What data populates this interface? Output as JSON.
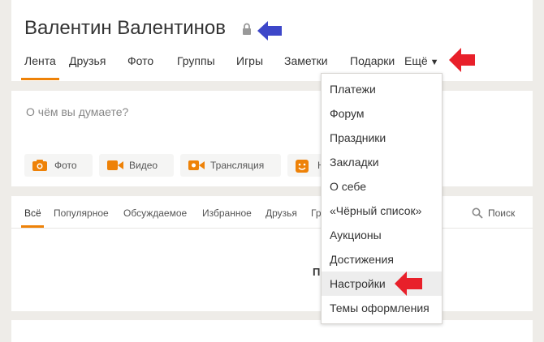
{
  "profile": {
    "name": "Валентин Валентинов",
    "tabs": [
      {
        "label": "Лента"
      },
      {
        "label": "Друзья"
      },
      {
        "label": "Фото"
      },
      {
        "label": "Группы"
      },
      {
        "label": "Игры"
      },
      {
        "label": "Заметки"
      },
      {
        "label": "Подарки"
      },
      {
        "label": "Ещё"
      }
    ],
    "more_caret": "▼",
    "active_tab": "Лента"
  },
  "post": {
    "placeholder": "О чём вы думаете?",
    "actions": [
      {
        "label": "Фото",
        "icon": "camera-icon"
      },
      {
        "label": "Видео",
        "icon": "video-camera-icon"
      },
      {
        "label": "Трансляция",
        "icon": "broadcast-icon"
      },
      {
        "label": "Н",
        "icon": "smiley-icon"
      }
    ]
  },
  "feed": {
    "tabs": [
      {
        "label": "Всё"
      },
      {
        "label": "Популярное"
      },
      {
        "label": "Обсуждаемое"
      },
      {
        "label": "Избранное"
      },
      {
        "label": "Друзья"
      },
      {
        "label": "Гр"
      }
    ],
    "search_label": "Поиск",
    "content_fragment": "П"
  },
  "dropdown": {
    "items": [
      {
        "label": "Платежи"
      },
      {
        "label": "Форум"
      },
      {
        "label": "Праздники"
      },
      {
        "label": "Закладки"
      },
      {
        "label": "О себе"
      },
      {
        "label": "«Чёрный список»"
      },
      {
        "label": "Аукционы"
      },
      {
        "label": "Достижения"
      },
      {
        "label": "Настройки"
      },
      {
        "label": "Темы оформления"
      }
    ],
    "highlighted": "Настройки"
  },
  "colors": {
    "accent": "#ee8208",
    "annotation_blue": "#3d47c9",
    "annotation_red": "#e8202a",
    "background": "#eeece8"
  }
}
